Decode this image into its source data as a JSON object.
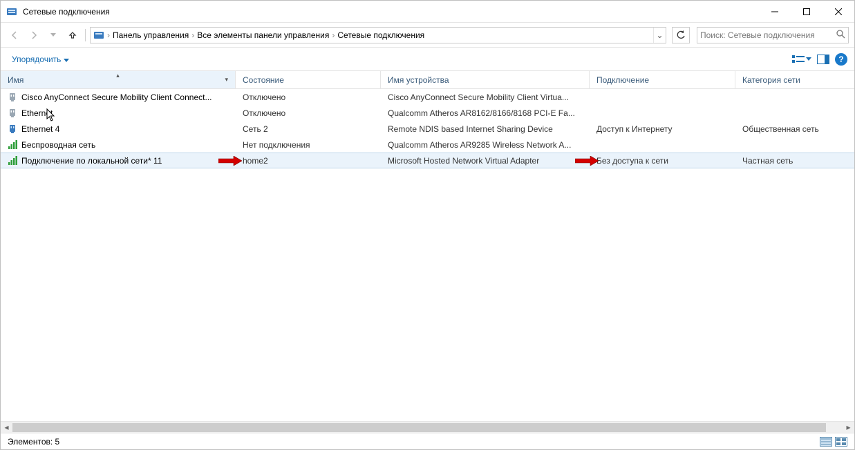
{
  "window": {
    "title": "Сетевые подключения"
  },
  "breadcrumb": {
    "items": [
      "Панель управления",
      "Все элементы панели управления",
      "Сетевые подключения"
    ]
  },
  "search": {
    "placeholder": "Поиск: Сетевые подключения"
  },
  "toolbar": {
    "organize": "Упорядочить"
  },
  "columns": {
    "name": "Имя",
    "state": "Состояние",
    "device_name": "Имя устройства",
    "connectivity": "Подключение",
    "category": "Категория сети"
  },
  "rows": [
    {
      "icon": "eth-disabled",
      "name": "Cisco AnyConnect Secure Mobility Client Connect...",
      "state": "Отключено",
      "device": "Cisco AnyConnect Secure Mobility Client Virtua...",
      "conn": "",
      "cat": ""
    },
    {
      "icon": "eth-disabled",
      "name": "Ethernet",
      "state": "Отключено",
      "device": "Qualcomm Atheros AR8162/8166/8168 PCI-E Fa...",
      "conn": "",
      "cat": ""
    },
    {
      "icon": "eth",
      "name": "Ethernet 4",
      "state": "Сеть 2",
      "device": "Remote NDIS based Internet Sharing Device",
      "conn": "Доступ к Интернету",
      "cat": "Общественная сеть"
    },
    {
      "icon": "wifi",
      "name": "Беспроводная сеть",
      "state": "Нет подключения",
      "device": "Qualcomm Atheros AR9285 Wireless Network A...",
      "conn": "",
      "cat": ""
    },
    {
      "icon": "wifi",
      "name": "Подключение по локальной сети* 11",
      "state": "home2",
      "device": "Microsoft Hosted Network Virtual Adapter",
      "conn": "Без доступа к сети",
      "cat": "Частная сеть",
      "selected": true
    }
  ],
  "status": {
    "items_label": "Элементов:",
    "count": "5"
  }
}
